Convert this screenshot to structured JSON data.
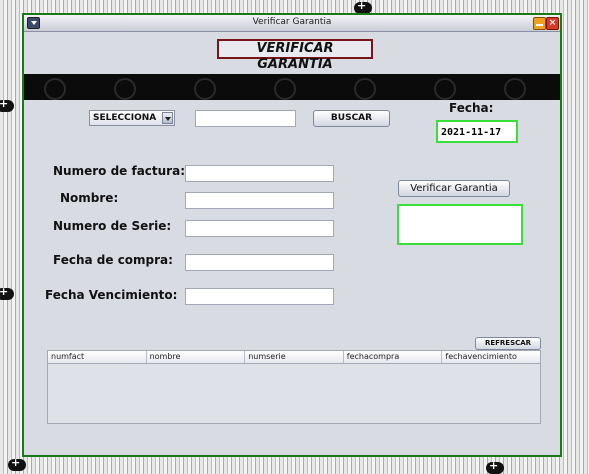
{
  "window": {
    "title": "Verificar Garantia"
  },
  "header": {
    "title": "VERIFICAR GARANTIA"
  },
  "search": {
    "combo_value": "SELECCIONA",
    "input_value": "",
    "button_label": "BUSCAR"
  },
  "date": {
    "label": "Fecha:",
    "value": "2021-11-17"
  },
  "form": {
    "invoice_label": "Numero de factura:",
    "name_label": "Nombre:",
    "serial_label": "Numero de Serie:",
    "purchase_date_label": "Fecha de compra:",
    "expiry_date_label": "Fecha Vencimiento:"
  },
  "verify": {
    "button_label": "Verificar Garantia",
    "result_text": ""
  },
  "table": {
    "refresh_label": "REFRESCAR",
    "columns": [
      "numfact",
      "nombre",
      "numserie",
      "fechacompra",
      "fechavencimiento"
    ]
  },
  "colors": {
    "window_border": "#1a7a1a",
    "highlight_border": "#39e03a",
    "title_border": "#7a1515"
  },
  "icons": [
    "window-menu-icon",
    "minimize-icon",
    "close-icon",
    "dropdown-arrow-icon",
    "gamepad-icon"
  ]
}
